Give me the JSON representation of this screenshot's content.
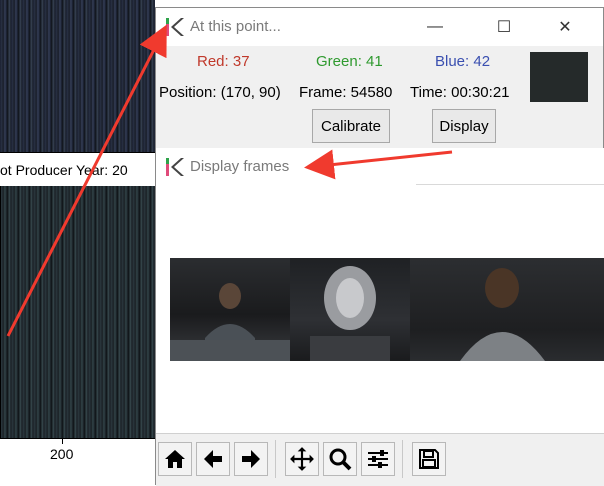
{
  "background": {
    "caption": "ot  Producer Year: 20",
    "tick_label": "200"
  },
  "window1": {
    "title": "At this point...",
    "red": "Red: 37",
    "green": "Green: 41",
    "blue": "Blue: 42",
    "position": "Position: (170, 90)",
    "frame": "Frame: 54580",
    "time": "Time: 00:30:21",
    "calibrate_label": "Calibrate",
    "display_label": "Display",
    "minimize_glyph": "—",
    "maximize_glyph": "☐",
    "close_glyph": "✕",
    "swatch_color": "#252a2a",
    "colors": {
      "red": "#c0392b",
      "green": "#2f9a2f",
      "blue": "#3a4fb0"
    }
  },
  "window2": {
    "title": "Display frames",
    "toolbar": {
      "icons": [
        "home-icon",
        "back-arrow-icon",
        "forward-arrow-icon",
        "pan-icon",
        "zoom-icon",
        "configure-icon",
        "save-icon"
      ]
    }
  },
  "annotation_color": "#f03a2e"
}
